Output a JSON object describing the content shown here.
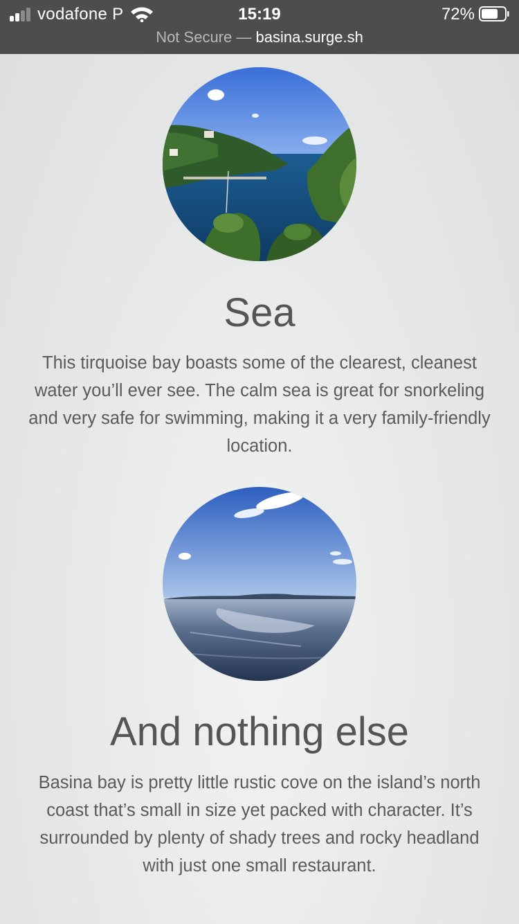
{
  "status_bar": {
    "carrier": "vodafone P",
    "time": "15:19",
    "battery_percent": "72%",
    "battery_level": 0.72,
    "signal_bars_filled": 2,
    "signal_bars_total": 4,
    "icons": [
      "signal-icon",
      "wifi-icon",
      "battery-icon"
    ]
  },
  "address_bar": {
    "security_label": "Not Secure —",
    "host": "basina.surge.sh"
  },
  "sections": [
    {
      "title": "Sea",
      "text": "This tirquoise bay boasts some of the clearest, cleanest water you’ll ever see. The calm sea is great for snorkeling and very safe for swimming, making it a very family-friendly location."
    },
    {
      "title": "And nothing else",
      "text": "Basina bay is pretty little rustic cove on the island’s north coast that’s small in size yet packed with character. It’s surrounded by plenty of shady trees and rocky headland with just one small restaurant."
    }
  ],
  "colors": {
    "status_bar_bg": "#4d4d4d",
    "heading": "#555555",
    "body_text": "#5a5a5a",
    "page_bg": "#e8eaea"
  }
}
